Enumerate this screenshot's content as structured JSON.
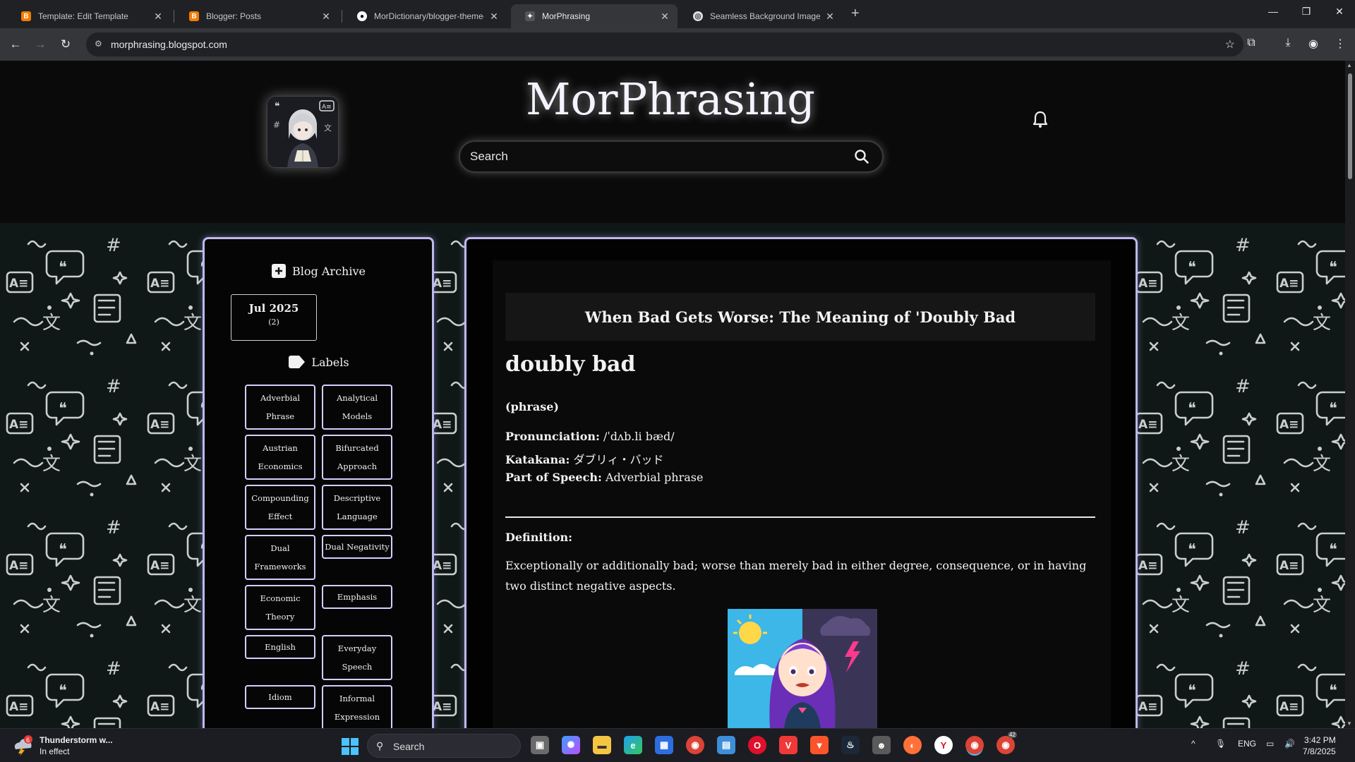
{
  "browser": {
    "tabs": [
      {
        "title": "Template: Edit Template",
        "favicon": "blogger-icon",
        "active": false
      },
      {
        "title": "Blogger: Posts",
        "favicon": "blogger-icon",
        "active": false
      },
      {
        "title": "MorDictionary/blogger-theme-",
        "favicon": "github-icon",
        "active": false
      },
      {
        "title": "MorPhrasing",
        "favicon": "morphrasing-icon",
        "active": true
      },
      {
        "title": "Seamless Background Image C",
        "favicon": "globe-icon",
        "active": false
      }
    ],
    "url": "morphrasing.blogspot.com",
    "colors": {
      "chrome": "#202124",
      "toolbar": "#35363a"
    }
  },
  "header": {
    "site_title": "MorPhrasing",
    "search_placeholder": "Search"
  },
  "sidebar": {
    "archive_heading": "Blog Archive",
    "archive": [
      {
        "month": "Jul 2025",
        "count": "(2)"
      }
    ],
    "labels_heading": "Labels",
    "labels": [
      "Adverbial Phrase",
      "Analytical Models",
      "Austrian Economics",
      "Bifurcated Approach",
      "Compounding Effect",
      "Descriptive Language",
      "Dual Frameworks",
      "Dual Negativity",
      "Economic Theory",
      "Emphasis",
      "English",
      "Everyday Speech",
      "Idiom",
      "Informal Expression"
    ],
    "border_color": "#bdb8f0"
  },
  "post": {
    "title": "When Bad Gets Worse: The Meaning of 'Doubly Bad",
    "word": "doubly bad",
    "word_type": "(phrase)",
    "pronunciation_label": "Pronunciation:",
    "pronunciation": " /ˈdʌb.li bæd/",
    "katakana_label": "Katakana:",
    "katakana": " ダブリィ・バッド",
    "pos_label": "Part of Speech:",
    "pos": " Adverbial phrase",
    "definition_label": "Definition:",
    "definition": "Exceptionally or additionally bad; worse than merely bad in either degree, consequence, or in having two distinct negative aspects."
  },
  "taskbar": {
    "weather_title": "Thunderstorm w...",
    "weather_sub": "In effect",
    "weather_badge": "6",
    "search_placeholder": "Search",
    "lang": "ENG",
    "time": "3:42 PM",
    "date": "7/8/2025",
    "chrome_badge": "42"
  }
}
